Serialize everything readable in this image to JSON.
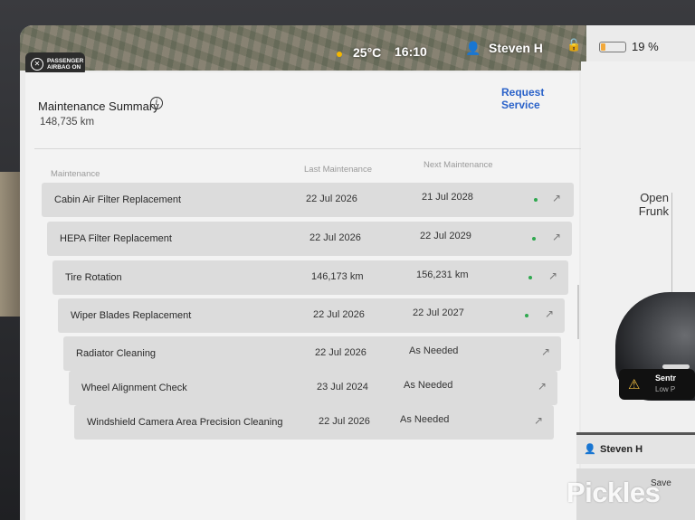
{
  "status_bar": {
    "airbag": {
      "line1": "PASSENGER",
      "line2": "AIRBAG ON",
      "icon": "airbag-off-icon"
    },
    "temperature": "25°C",
    "time": "16:10",
    "user": "Steven H",
    "battery_pct": "19 %",
    "battery_level": 0.19,
    "battery_color": "#f2a93b"
  },
  "maintenance": {
    "title": "Maintenance Summary",
    "odometer": "148,735 km",
    "request_service": "Request Service",
    "accent_color": "#2a62c9",
    "columns": {
      "name": "Maintenance",
      "last": "Last Maintenance",
      "next": "Next Maintenance"
    },
    "items": [
      {
        "name": "Cabin Air Filter Replacement",
        "last": "22 Jul 2026",
        "next": "21 Jul 2028",
        "ok": true
      },
      {
        "name": "HEPA Filter Replacement",
        "last": "22 Jul 2026",
        "next": "22 Jul 2029",
        "ok": true
      },
      {
        "name": "Tire Rotation",
        "last": "146,173 km",
        "next": "156,231 km",
        "ok": true
      },
      {
        "name": "Wiper Blades Replacement",
        "last": "22 Jul 2026",
        "next": "22 Jul 2027",
        "ok": true
      },
      {
        "name": "Radiator Cleaning",
        "last": "22 Jul 2026",
        "next": "As Needed",
        "ok": false
      },
      {
        "name": "Wheel Alignment Check",
        "last": "23 Jul 2024",
        "next": "As Needed",
        "ok": false
      },
      {
        "name": "Windshield Camera Area Precision Cleaning",
        "last": "22 Jul 2026",
        "next": "As Needed",
        "ok": false
      }
    ]
  },
  "right_panel": {
    "frunk_line1": "Open",
    "frunk_line2": "Frunk",
    "sentry_title": "Sentr",
    "sentry_sub": "Low P",
    "profile_name": "Steven H",
    "save_label": "Save"
  },
  "watermark": "Pickles"
}
